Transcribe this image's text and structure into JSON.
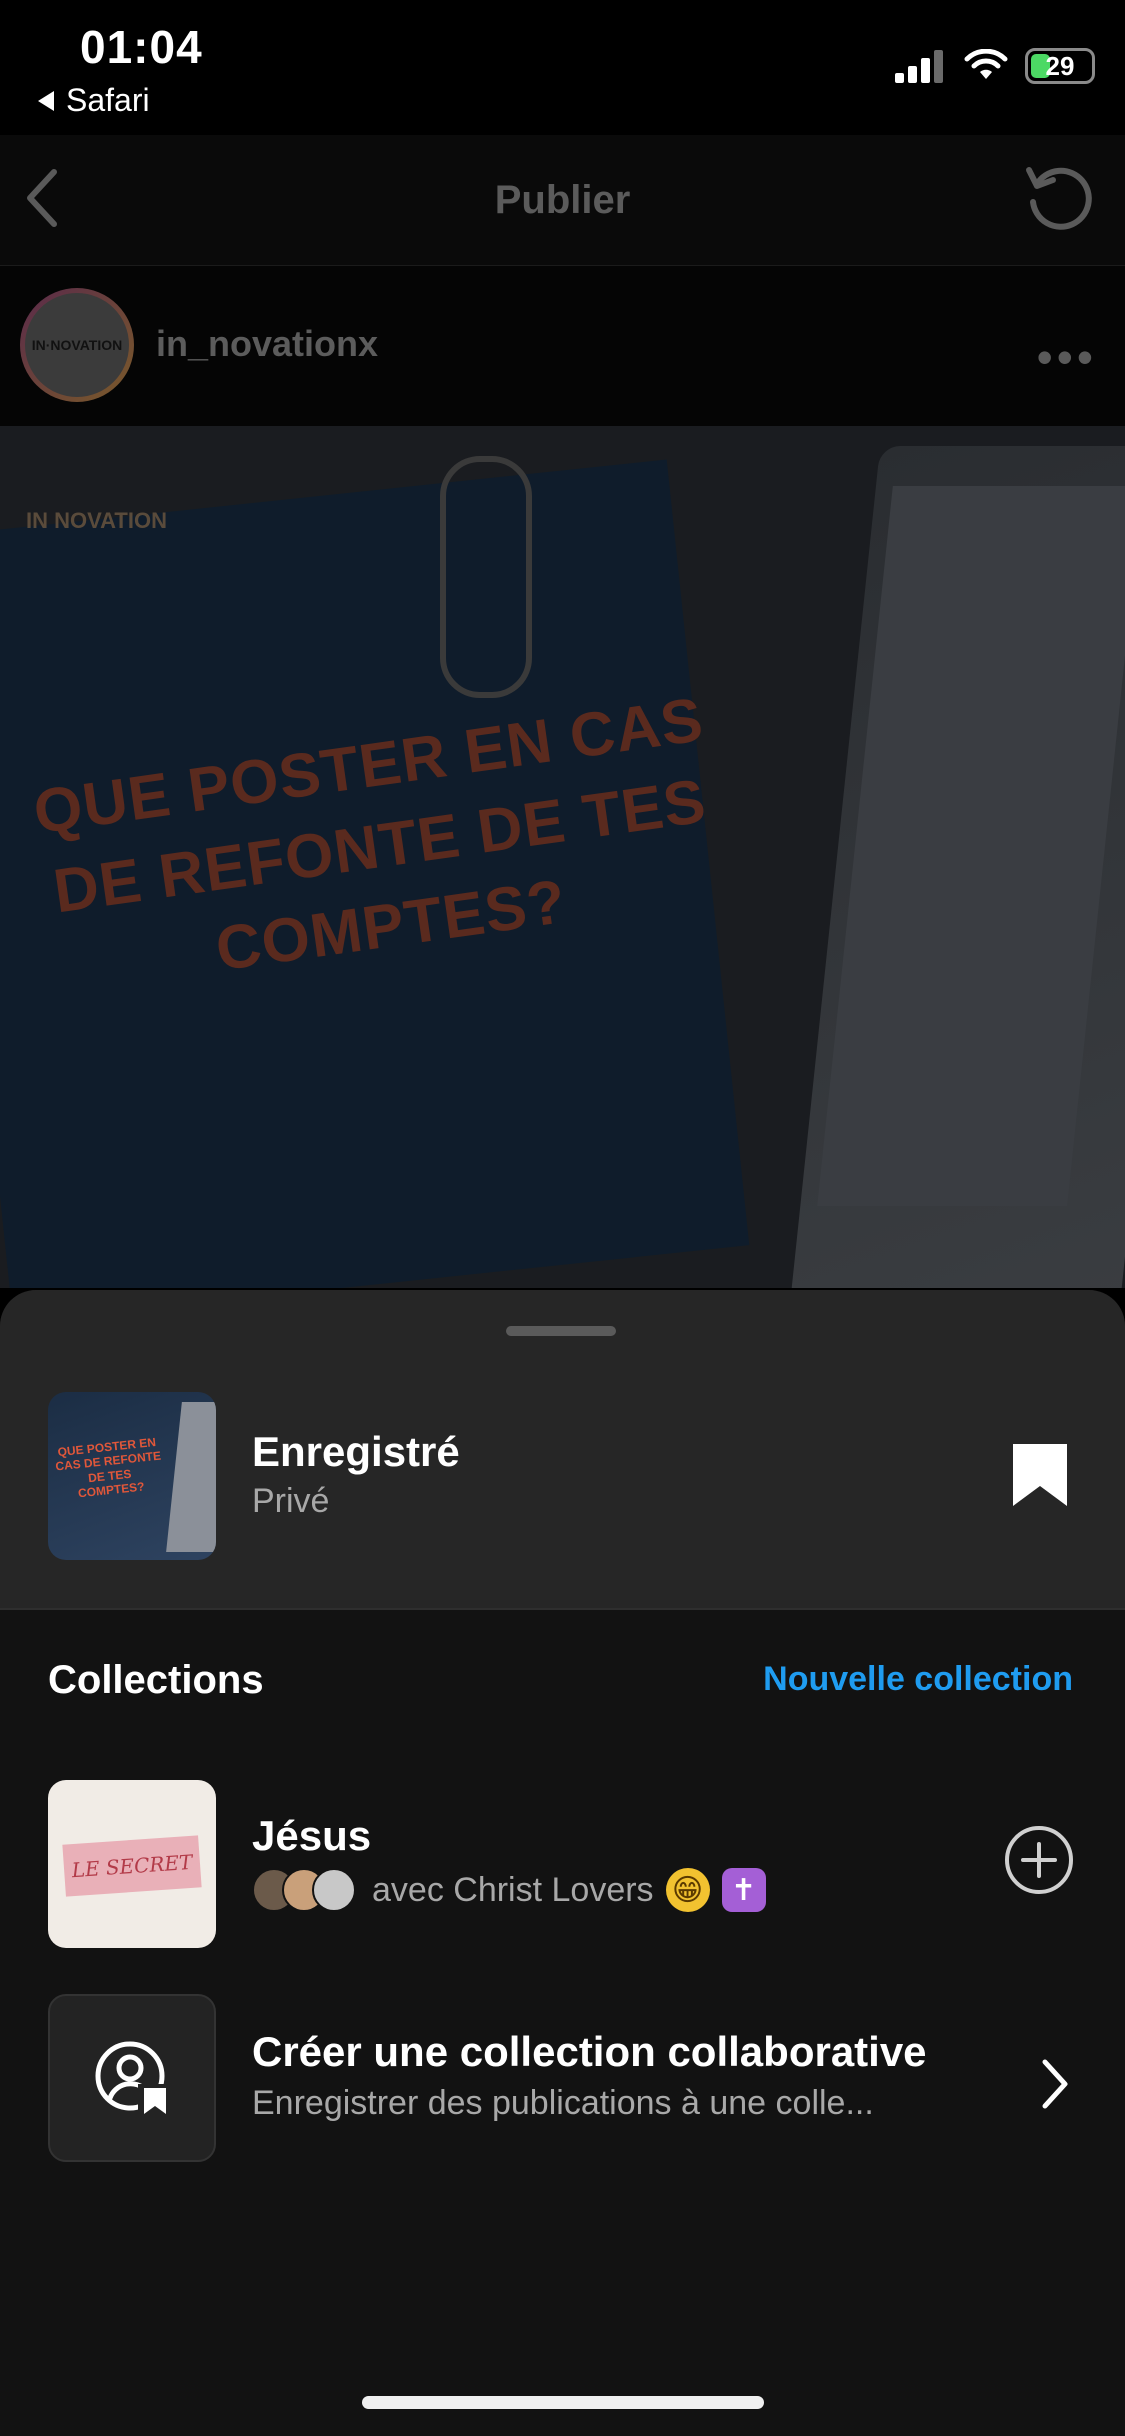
{
  "status_bar": {
    "time": "01:04",
    "back_app": "Safari",
    "battery_level": "29",
    "battery_fraction": 0.29
  },
  "header": {
    "title": "Publier"
  },
  "post": {
    "username": "in_novationx",
    "headline": "QUE POSTER EN CAS DE REFONTE DE TES COMPTES?",
    "brand_watermark": "IN NOVATION"
  },
  "sheet": {
    "saved": {
      "title": "Enregistré",
      "subtitle": "Privé",
      "thumb_text": "QUE POSTER EN CAS DE REFONTE DE TES COMPTES?"
    },
    "collections_label": "Collections",
    "new_collection_label": "Nouvelle collection",
    "collections": [
      {
        "title": "Jésus",
        "subtitle": "avec Christ Lovers",
        "thumb_text": "LE SECRET",
        "emojis": [
          "😁",
          "✝"
        ]
      },
      {
        "title": "Créer une collection collaborative",
        "subtitle": "Enregistrer des publications à une colle..."
      }
    ]
  },
  "colors": {
    "accent": "#1f9cf0",
    "sheet_top": "#262626",
    "sheet_bg": "#121212"
  },
  "icons": [
    "signal-icon",
    "wifi-icon",
    "battery-icon",
    "back-arrow-icon",
    "refresh-icon",
    "more-icon",
    "bookmark-icon",
    "add-circle-icon",
    "collab-user-icon",
    "chevron-right-icon"
  ]
}
